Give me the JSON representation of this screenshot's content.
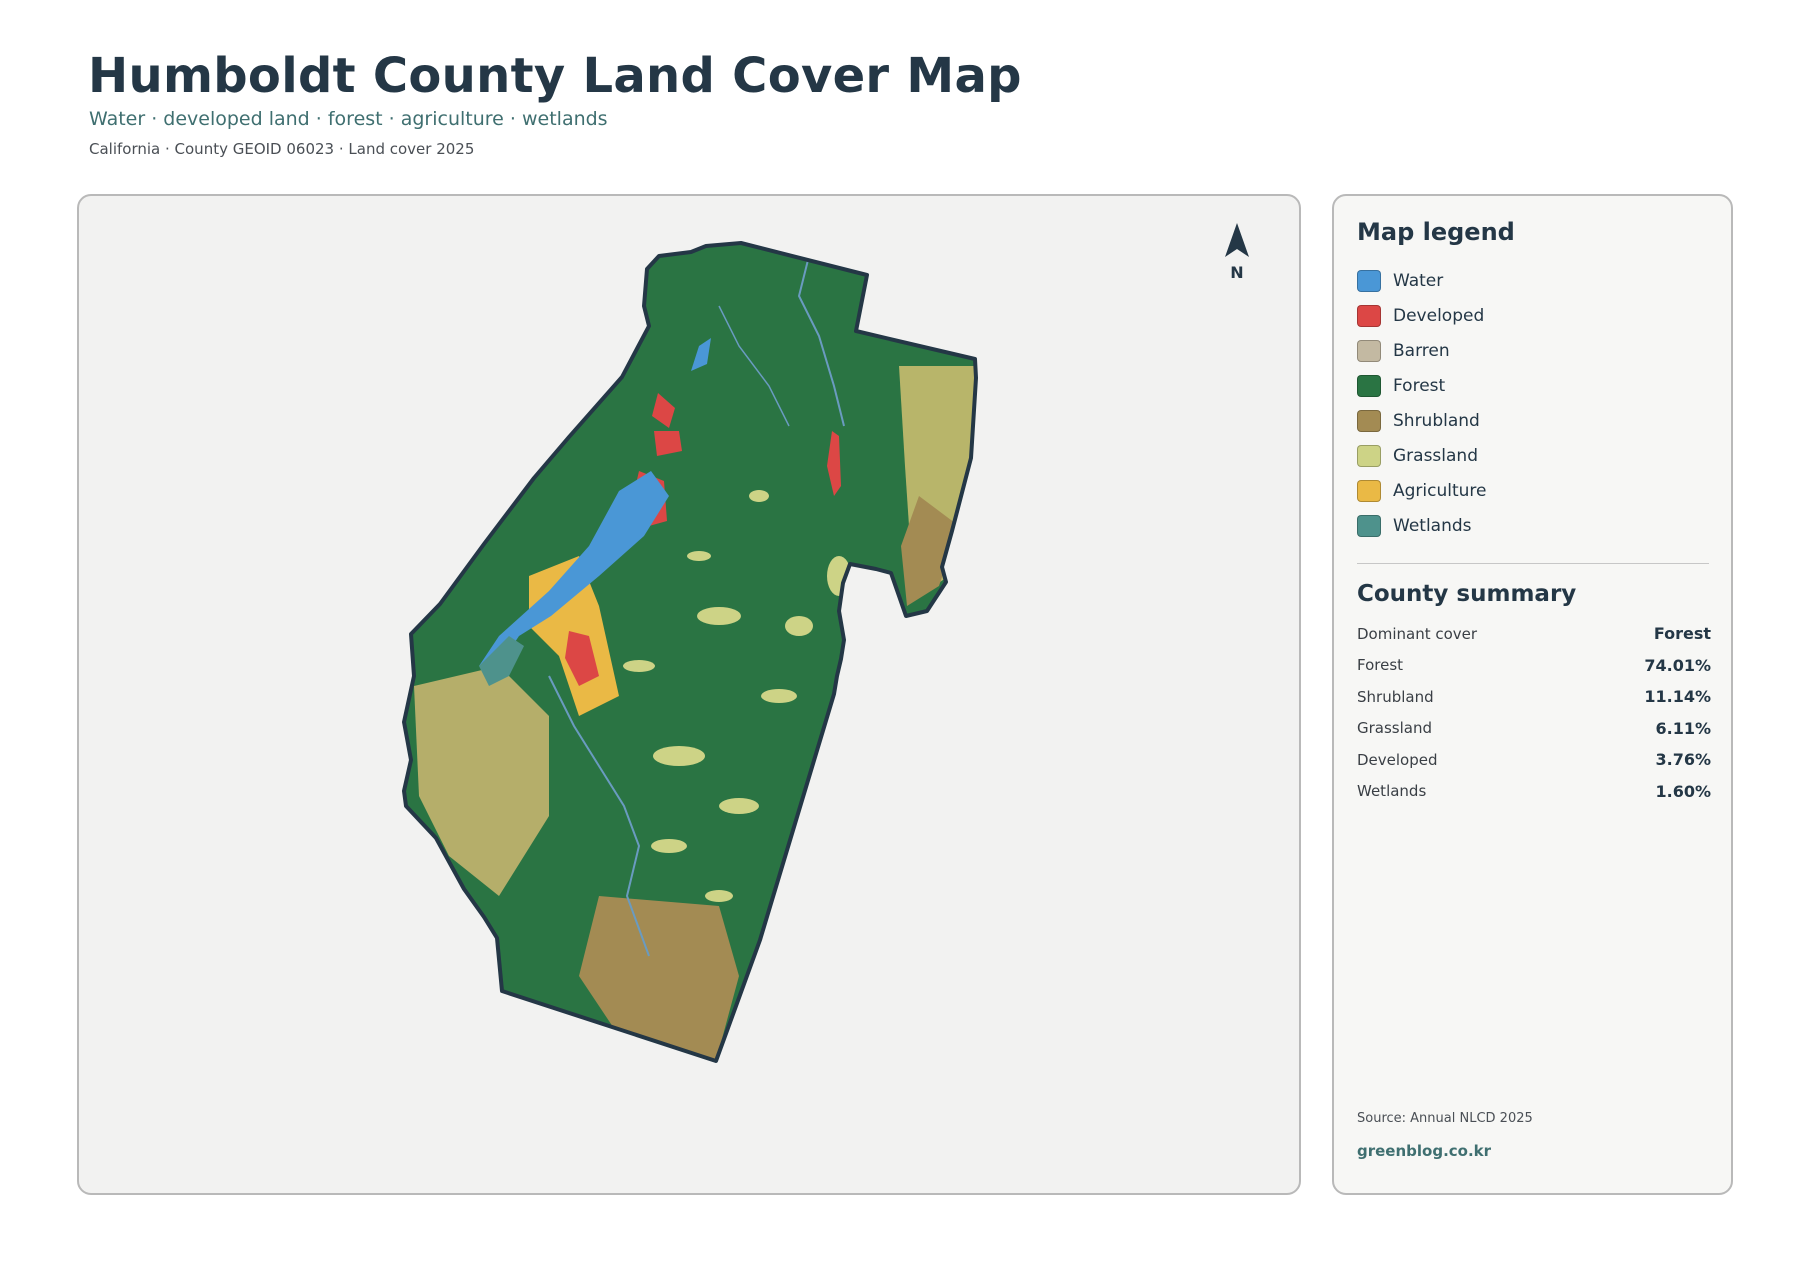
{
  "header": {
    "title": "Humboldt County Land Cover Map",
    "subtitle": "Water · developed land · forest · agriculture · wetlands",
    "meta": "California · County GEOID 06023 · Land cover 2025"
  },
  "map": {
    "north_label": "N",
    "colors": {
      "background": "#f2f2f1",
      "outline": "#243746",
      "forest": "#2a7443",
      "water": "#4a97d6",
      "developed": "#dc4745",
      "barren": "#c3b9a2",
      "shrubland": "#a38b53",
      "grassland": "#cdd386",
      "agriculture": "#eab945",
      "wetlands": "#4e928c"
    }
  },
  "legend": {
    "title": "Map legend",
    "items": [
      {
        "label": "Water",
        "color": "#4a97d6"
      },
      {
        "label": "Developed",
        "color": "#dc4745"
      },
      {
        "label": "Barren",
        "color": "#c3b9a2"
      },
      {
        "label": "Forest",
        "color": "#2a7443"
      },
      {
        "label": "Shrubland",
        "color": "#a38b53"
      },
      {
        "label": "Grassland",
        "color": "#cdd386"
      },
      {
        "label": "Agriculture",
        "color": "#eab945"
      },
      {
        "label": "Wetlands",
        "color": "#4e928c"
      }
    ]
  },
  "summary": {
    "title": "County summary",
    "rows": [
      {
        "label": "Dominant cover",
        "value": "Forest"
      },
      {
        "label": "Forest",
        "value": "74.01%"
      },
      {
        "label": "Shrubland",
        "value": "11.14%"
      },
      {
        "label": "Grassland",
        "value": "6.11%"
      },
      {
        "label": "Developed",
        "value": "3.76%"
      },
      {
        "label": "Wetlands",
        "value": "1.60%"
      }
    ]
  },
  "footer": {
    "source": "Source: Annual NLCD 2025",
    "site": "greenblog.co.kr"
  }
}
